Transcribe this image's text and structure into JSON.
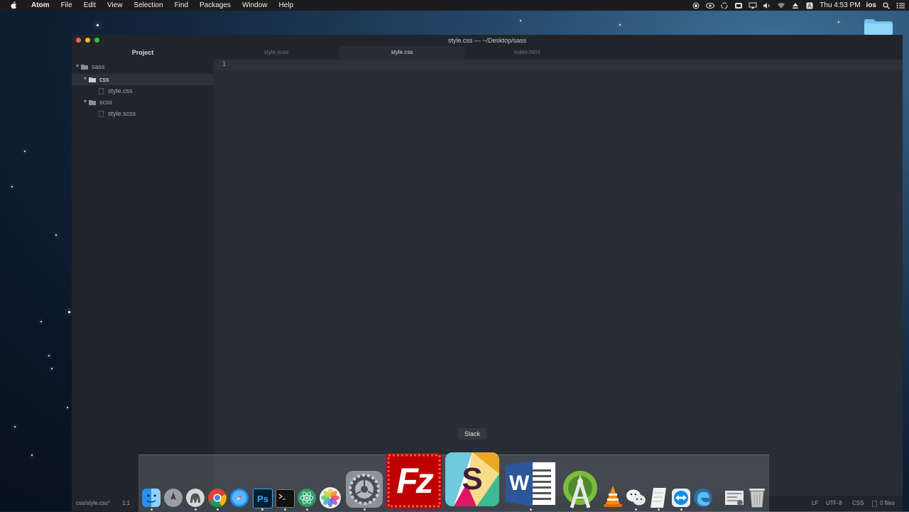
{
  "menubar": {
    "app": "Atom",
    "items": [
      "File",
      "Edit",
      "View",
      "Selection",
      "Find",
      "Packages",
      "Window",
      "Help"
    ],
    "clock": "Thu 4:53 PM",
    "user": "ios",
    "tray_icons": [
      "record-icon",
      "eye-icon",
      "sync-icon",
      "cloud-icon",
      "airplay-icon",
      "volume-icon",
      "wifi-icon",
      "eject-icon",
      "keyboard-input-icon"
    ]
  },
  "window": {
    "title": "style.css — ~/Desktop/sass",
    "traffic_lights": {
      "close": "#ff5f57",
      "minimize": "#febc2e",
      "zoom": "#28c840"
    }
  },
  "tree": {
    "header": "Project",
    "items": [
      {
        "label": "sass",
        "type": "folder",
        "expanded": true,
        "depth": 0
      },
      {
        "label": "css",
        "type": "folder",
        "expanded": true,
        "depth": 1,
        "selected": true
      },
      {
        "label": "style.css",
        "type": "file",
        "depth": 2
      },
      {
        "label": "scss",
        "type": "folder",
        "expanded": true,
        "depth": 1
      },
      {
        "label": "style.scss",
        "type": "file",
        "depth": 2
      }
    ]
  },
  "tabs": [
    {
      "label": "style.scss",
      "active": false
    },
    {
      "label": "style.css",
      "active": true
    },
    {
      "label": "index.html",
      "active": false
    }
  ],
  "editor": {
    "line_number": "1"
  },
  "statusbar": {
    "file": "css/style.css*",
    "cursor": "1:1",
    "line_ending": "LF",
    "encoding": "UTF-8",
    "grammar": "CSS",
    "files": "0 files"
  },
  "dock": {
    "tooltip": "Slack",
    "fz_label": "Fz",
    "slack_letter": "S",
    "word_letter": "W",
    "ps_label": "Ps",
    "apps": [
      "finder-icon",
      "launchpad-icon",
      "sequel-pro-icon",
      "chrome-icon",
      "safari-icon",
      "photoshop-icon",
      "terminal-icon",
      "atom-icon",
      "photos-icon",
      "system-preferences-icon",
      "filezilla-icon",
      "slack-icon",
      "word-icon",
      "android-studio-icon",
      "vlc-icon",
      "wechat-icon",
      "notes-icon",
      "teamviewer-icon",
      "edge-icon",
      "downloads-icon",
      "trash-icon"
    ]
  }
}
